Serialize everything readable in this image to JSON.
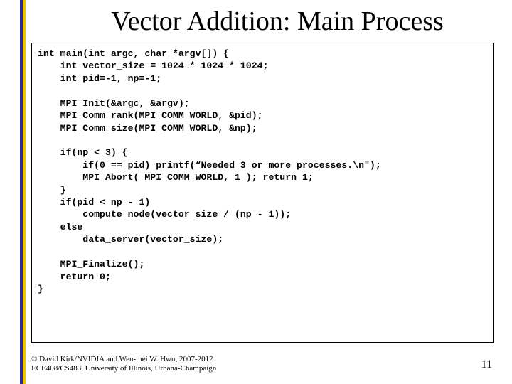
{
  "title": "Vector Addition: Main Process",
  "code_lines": [
    "int main(int argc, char *argv[]) {",
    "    int vector_size = 1024 * 1024 * 1024;",
    "    int pid=-1, np=-1;",
    "",
    "    MPI_Init(&argc, &argv);",
    "    MPI_Comm_rank(MPI_COMM_WORLD, &pid);",
    "    MPI_Comm_size(MPI_COMM_WORLD, &np);",
    "",
    "    if(np < 3) {",
    "        if(0 == pid) printf(“Needed 3 or more processes.\\n\");",
    "        MPI_Abort( MPI_COMM_WORLD, 1 ); return 1;",
    "    }",
    "    if(pid < np - 1)",
    "        compute_node(vector_size / (np - 1));",
    "    else",
    "        data_server(vector_size);",
    "",
    "    MPI_Finalize();",
    "    return 0;",
    "}"
  ],
  "footer_line1": "© David Kirk/NVIDIA and Wen-mei W. Hwu, 2007-2012",
  "footer_line2": "ECE408/CS483, University of Illinois, Urbana-Champaign",
  "page_number": "11"
}
